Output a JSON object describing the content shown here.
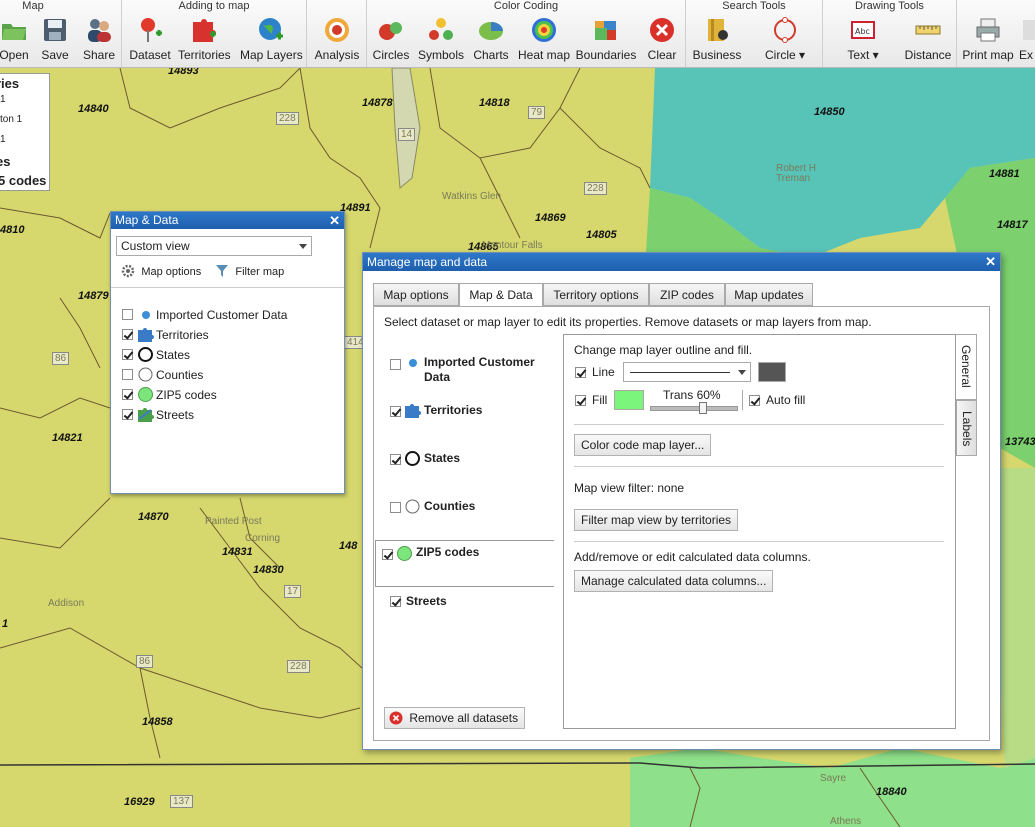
{
  "toolbar": {
    "groups": [
      {
        "title": "Map",
        "buttons": [
          {
            "label": "Open",
            "icon": "folder-open-icon"
          },
          {
            "label": "Save",
            "icon": "floppy-disk-icon"
          },
          {
            "label": "Share",
            "icon": "share-users-icon"
          }
        ]
      },
      {
        "title": "Adding to map",
        "buttons": [
          {
            "label": "Dataset",
            "icon": "pushpin-plus-icon"
          },
          {
            "label": "Territories",
            "icon": "puzzle-plus-icon"
          },
          {
            "label": "Map Layers",
            "icon": "globe-plus-icon"
          }
        ]
      },
      {
        "title": "",
        "buttons": [
          {
            "label": "Analysis",
            "icon": "target-icon"
          }
        ]
      },
      {
        "title": "Color Coding",
        "buttons": [
          {
            "label": "Circles",
            "icon": "circles-icon"
          },
          {
            "label": "Symbols",
            "icon": "symbols-icon"
          },
          {
            "label": "Charts",
            "icon": "pie-chart-icon"
          },
          {
            "label": "Heat map",
            "icon": "heat-map-icon"
          },
          {
            "label": "Boundaries",
            "icon": "puzzle-boundaries-icon"
          },
          {
            "label": "Clear",
            "icon": "clear-x-icon"
          }
        ]
      },
      {
        "title": "Search Tools",
        "buttons": [
          {
            "label": "Business",
            "icon": "business-book-icon"
          },
          {
            "label": "Circle",
            "icon": "circle-search-icon"
          }
        ]
      },
      {
        "title": "Drawing Tools",
        "buttons": [
          {
            "label": "Text",
            "icon": "text-box-icon"
          },
          {
            "label": "Distance",
            "icon": "ruler-icon"
          }
        ]
      },
      {
        "title": "",
        "buttons": [
          {
            "label": "Print map",
            "icon": "printer-icon"
          },
          {
            "label": "Ex",
            "icon": "export-icon"
          }
        ]
      }
    ]
  },
  "legend": {
    "lines": [
      "ries",
      "1",
      "ton 1",
      "1",
      "es",
      "5 codes"
    ]
  },
  "map": {
    "zips": [
      "14893",
      "14840",
      "14878",
      "14818",
      "14850",
      "14881",
      "4810",
      "14891",
      "14869",
      "14805",
      "14865",
      "14817",
      "14879",
      "14821",
      "13743",
      "14870",
      "14831",
      "14830",
      "148",
      "14858",
      "16929",
      "18840",
      "1"
    ],
    "towns": [
      "Watkins Glen",
      "Robert H Treman",
      "Montour Falls",
      "Painted Post",
      "Corning",
      "Addison",
      "Sayre",
      "Athens"
    ],
    "road_shields": [
      "79",
      "228",
      "14",
      "228",
      "414",
      "86",
      "17",
      "86",
      "228",
      "137"
    ]
  },
  "map_data_panel": {
    "title": "Map & Data",
    "view_select": "Custom view",
    "map_options": "Map options",
    "filter_map": "Filter map",
    "layers": [
      {
        "label": "Imported Customer Data",
        "checked": false,
        "icon": "blue-dot-icon"
      },
      {
        "label": "Territories",
        "checked": true,
        "icon": "territories-puzzle-icon"
      },
      {
        "label": "States",
        "checked": true,
        "icon": "states-ring-icon"
      },
      {
        "label": "Counties",
        "checked": false,
        "icon": "counties-ring-icon"
      },
      {
        "label": "ZIP5 codes",
        "checked": true,
        "icon": "zip-green-circle-icon"
      },
      {
        "label": "Streets",
        "checked": true,
        "icon": "streets-puzzle-icon"
      }
    ]
  },
  "manage_dialog": {
    "title": "Manage map and data",
    "tabs": [
      "Map options",
      "Map & Data",
      "Territory options",
      "ZIP codes",
      "Map updates"
    ],
    "active_tab": "Map & Data",
    "instructions": "Select dataset or map layer to edit its properties. Remove datasets or map layers from map.",
    "layers": [
      {
        "label": "Imported Customer Data",
        "checked": false
      },
      {
        "label": "Territories",
        "checked": true
      },
      {
        "label": "States",
        "checked": true
      },
      {
        "label": "Counties",
        "checked": false
      },
      {
        "label": "ZIP5 codes",
        "checked": true,
        "selected": true
      },
      {
        "label": "Streets",
        "checked": true
      }
    ],
    "remove_all": "Remove all datasets",
    "props": {
      "heading": "Change map layer outline and fill.",
      "line_label": "Line",
      "line_checked": true,
      "fill_label": "Fill",
      "fill_checked": true,
      "fill_color": "#7cf57c",
      "line_color": "#555555",
      "trans_label": "Trans 60%",
      "trans_value": 0.6,
      "auto_fill_label": "Auto fill",
      "auto_fill_checked": true,
      "color_code_btn": "Color code map layer...",
      "filter_text": "Map view filter: none",
      "filter_btn": "Filter map view by territories",
      "calc_text": "Add/remove or edit calculated data columns.",
      "calc_btn": "Manage calculated data columns..."
    },
    "side_tabs": [
      "General",
      "Labels"
    ]
  },
  "colors": {
    "title_bar": "#2466b8",
    "map_yellow": "#d9dc72",
    "map_teal": "#5cc8b4",
    "map_green": "#6ed86e"
  }
}
